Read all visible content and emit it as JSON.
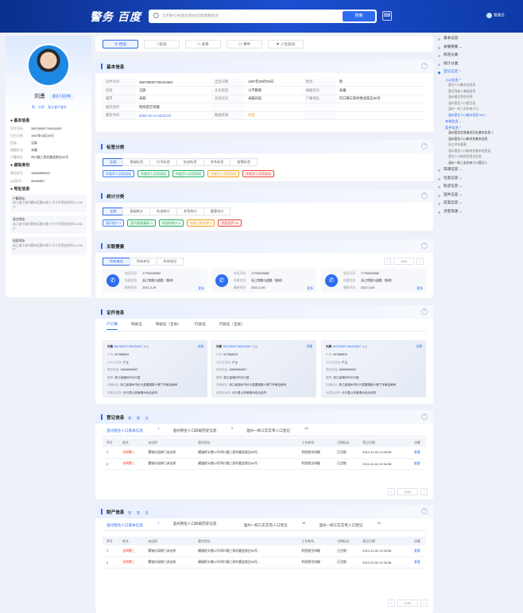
{
  "header": {
    "logo": "警务 百度",
    "search_placeholder": "全所账号/关键词/基站/因留/模糊查询",
    "search_btn": "搜索",
    "user": "管理员"
  },
  "profile": {
    "name": "刘勇",
    "badge": "重点人员详情",
    "tags": [
      "男",
      "33岁",
      "浙江省宁波市"
    ],
    "basic_title": "基本信息",
    "basic": [
      {
        "k": "证件号码:",
        "v": "35678908776543456​7"
      },
      {
        "k": "出生日期:",
        "v": "1987年08月09日"
      },
      {
        "k": "民族:",
        "v": "汉族"
      },
      {
        "k": "婚姻状况:",
        "v": "未婚"
      },
      {
        "k": "户籍地址:",
        "v": "市口镇三家村委会前庄50号"
      }
    ],
    "virtual_title": "虚拟身份",
    "virtual": [
      {
        "k": "微信账号:",
        "v": "15684589654"
      },
      {
        "k": "QQ账号:",
        "v": "45456657"
      }
    ],
    "address_title": "地址信息",
    "addresses": [
      {
        "k": "户籍地址:",
        "v": "浙江省宁波市鄞州区鄞州街十号寸车荣由房间16-256户"
      },
      {
        "k": "居住地址:",
        "v": "浙江省宁波市鄞州区鄞州街十号寸车荣由房间16-256户"
      },
      {
        "k": "现居地址:",
        "v": "浙江省宁波市鄞州区鄞州街十号寸车荣由房间16-256户"
      }
    ]
  },
  "top_tabs": [
    "档案",
    "轨迹",
    "关系",
    "事件",
    "人生轨迹"
  ],
  "basic_card": {
    "title": "基本信息",
    "rows": [
      [
        "证件号码",
        "356789087765434567",
        "出生日期",
        "1987年08月09日",
        "性别",
        "男"
      ],
      [
        "民族",
        "汉族",
        "文化程度",
        "小学教育",
        "婚姻状况",
        "未婚"
      ],
      [
        "籍贯",
        "未知",
        "兵役状况",
        "未服兵役",
        "户籍地址",
        "市口镇三家村委会前庄50号"
      ],
      [
        "服务处所",
        "利民航空母舰",
        "",
        "",
        "",
        ""
      ],
      [
        "最新时间",
        "2022-12-14 03:43:23",
        "数据来源",
        "住宿",
        "",
        ""
      ]
    ]
  },
  "tag_card": {
    "title": "标签分类",
    "segments": [
      "全部",
      "基础标签",
      "行为标签",
      "轨迹标签",
      "关系标签",
      "智慧标签"
    ],
    "chips": [
      "年度涉入员而流动",
      "年度涉入员而流动",
      "年度涉入员而流动",
      "年度涉入员而流动",
      "年度涉入员而流动"
    ],
    "chip_colors": [
      "#3b7cf5",
      "#27ae60",
      "#27ae60",
      "#f0a020",
      "#e74c3c"
    ]
  },
  "stat_card": {
    "title": "统计分类",
    "segments": [
      "全部",
      "基础统计",
      "轨迹统计",
      "关系统计",
      "重要统计"
    ],
    "chips": [
      "银行账户 2",
      "国内网络编码 3",
      "轨迹的统计 4",
      "年度入的房源 3",
      "涉股案件 35"
    ],
    "chip_colors": [
      "#3b7cf5",
      "#27ae60",
      "#27ae60",
      "#f0a020",
      "#e74c3c"
    ]
  },
  "relation_card": {
    "title": "关联要素",
    "segments": [
      "所有电话",
      "所有单位",
      "所有地址"
    ],
    "page": "1/50",
    "items": [
      {
        "l1": "电话号码",
        "v1": "17756325582",
        "l2": "所属信息",
        "v2": "浙江铁路与道路（查询）",
        "l3": "最新时间",
        "v3": "2022-3-26",
        "more": "更多"
      },
      {
        "l1": "电话号码",
        "v1": "17756325582",
        "l2": "所属信息",
        "v2": "浙江铁路与道路（查询）",
        "l3": "最新时间",
        "v3": "2022-3-26",
        "more": "更多"
      },
      {
        "l1": "电话号码",
        "v1": "17756325582",
        "l2": "所属信息",
        "v2": "浙江铁路与道路（查询）",
        "l3": "最新时间",
        "v3": "2022-3-26",
        "more": "更多"
      }
    ]
  },
  "cert_card": {
    "title": "证件信息",
    "tabs": [
      "户口簿",
      "驾驶证",
      "驾驶证（全省）",
      "行驶证",
      "行驶证（全省）"
    ],
    "detail": "详情",
    "cards": [
      {
        "name": "刘勇",
        "id": "356789087765434567",
        "tag": "派出",
        "rows": [
          [
            "户号:",
            "007888834"
          ],
          [
            "与户主关系:",
            "户主"
          ],
          [
            "联系电话:",
            "15684589567"
          ],
          [
            "籍贯:",
            "浙江省湖州市长兴县"
          ],
          [
            "详细地址:",
            "浙江省湖州市长兴县图湖镇十寨寸车荣由房间"
          ],
          [
            "所属派出所:",
            "长兴县公安局湖州北派出所"
          ]
        ]
      },
      {
        "name": "刘勇",
        "id": "356789087765434567",
        "tag": "派出",
        "rows": [
          [
            "户号:",
            "007888834"
          ],
          [
            "与户主关系:",
            "户主"
          ],
          [
            "联系电话:",
            "15684589567"
          ],
          [
            "籍贯:",
            "浙江省湖州市长兴县"
          ],
          [
            "详细地址:",
            "浙江省湖州市长兴县图湖镇十寨寸车荣由房间"
          ],
          [
            "所属派出所:",
            "长兴县公安局湖州北派出所"
          ]
        ]
      },
      {
        "name": "刘勇",
        "id": "356789087765434567",
        "tag": "派出",
        "rows": [
          [
            "户号:",
            "007888834"
          ],
          [
            "与户主关系:",
            "户主"
          ],
          [
            "联系电话:",
            "15684589567"
          ],
          [
            "籍贯:",
            "浙江省湖州市长兴县"
          ],
          [
            "详细地址:",
            "浙江省湖州市长兴县图湖镇十寨寸车荣由房间"
          ],
          [
            "所属派出所:",
            "长兴县公安局湖州北派出所"
          ]
        ]
      }
    ]
  },
  "reg_card": {
    "title": "登记信息",
    "minis": [
      "暂",
      "暂",
      "住"
    ],
    "tabs": [
      "温州暂住人口基本信息",
      "温州暂住人口四离历史信息",
      "温州一标三实实有人口登记"
    ],
    "tab_counts": [
      "1",
      "3",
      "10"
    ],
    "cols": [
      "序号",
      "姓名",
      "派出所",
      "暂住地址",
      "工作处所",
      "注销标志",
      "登记日期",
      "详情"
    ],
    "rows": [
      [
        "1",
        "张揭腾三",
        "蒙城分局南门派出所",
        "横渡桥头巷12号四口镇三家村委会前庄50号...",
        "利民航空母舰",
        "已注销",
        "2013-12-04 12:34:56",
        "查看"
      ],
      [
        "2",
        "张揭腾三",
        "蒙城分局南门派出所",
        "横渡桥头巷12号四口镇三家村委会前庄50号...",
        "利民航空母舰",
        "已注销",
        "2013-12-04 12:34:56",
        "查看"
      ]
    ],
    "page": "2/30"
  },
  "prop_card": {
    "title": "财产信息",
    "minis": [
      "暂",
      "暂",
      "住"
    ],
    "tabs": [
      "温州暂住人口基本信息",
      "温州暂住人口四离历史信息",
      "温州一标三实实有人口登记",
      "温州一标三实实有人口登记"
    ],
    "tab_counts": [
      "1",
      "",
      "10",
      "10"
    ],
    "cols": [
      "序号",
      "姓名",
      "派出所",
      "暂住地址",
      "工作处所",
      "注销标志",
      "登记日期",
      "详情"
    ],
    "rows": [
      [
        "1",
        "张揭腾三",
        "蒙城分局南门派出所",
        "横渡桥头巷12号四口镇三家村委会前庄50号...",
        "利民航空母舰",
        "已注销",
        "2013-12-04 12:34:56",
        "查看"
      ],
      [
        "2",
        "张揭腾三",
        "蒙城分局南门派出所",
        "横渡桥头巷12号四口镇三家村委会前庄50号...",
        "利民航空母舰",
        "已注销",
        "2013-12-04 12:34:56",
        "查看"
      ]
    ],
    "page": "2/30"
  },
  "right_nav": [
    {
      "t": "g",
      "label": "基本信息"
    },
    {
      "t": "g",
      "label": "关联要素 ⌄"
    },
    {
      "t": "g",
      "label": "标签分类"
    },
    {
      "t": "g",
      "label": "统计分类"
    },
    {
      "t": "g",
      "label": "登记信息 ^",
      "on": true
    },
    {
      "t": "h",
      "label": "人口信息 ^"
    },
    {
      "t": "s",
      "label": "暂住人口基本信息表"
    },
    {
      "t": "s",
      "label": "暂住残疾人基础信息"
    },
    {
      "t": "s",
      "label": "温州居民身份证明"
    },
    {
      "t": "s",
      "label": "温州暂住人口居住证"
    },
    {
      "t": "s",
      "label": "温州一标三实实有人口"
    },
    {
      "t": "s",
      "label": "温州暂住人口基本信息 900+",
      "on": true
    },
    {
      "t": "h",
      "label": "车辆信息 ⌄"
    },
    {
      "t": "h",
      "label": "案件信息 ^"
    },
    {
      "t": "s",
      "label": "温州暂住信息基本历史基本信息 1",
      "dk": true
    },
    {
      "t": "s",
      "label": "温州暂住人口新综合基本信息",
      "dk": true
    },
    {
      "t": "s",
      "label": "浙江评价备案"
    },
    {
      "t": "s",
      "label": "温州暂住人口新综合基本信息温"
    },
    {
      "t": "s",
      "label": "暂住人口新综合登记信息"
    },
    {
      "t": "s",
      "label": "温州一标三实实有人口登记 1",
      "dk": true
    },
    {
      "t": "g",
      "label": "车辆信息 ⌄"
    },
    {
      "t": "g",
      "label": "社会信息 ⌄"
    },
    {
      "t": "g",
      "label": "轨迹信息 ⌄"
    },
    {
      "t": "g",
      "label": "案件信息 ⌄"
    },
    {
      "t": "g",
      "label": "前案信息 ⌄"
    },
    {
      "t": "g",
      "label": "涉密资源 ⌄"
    }
  ]
}
